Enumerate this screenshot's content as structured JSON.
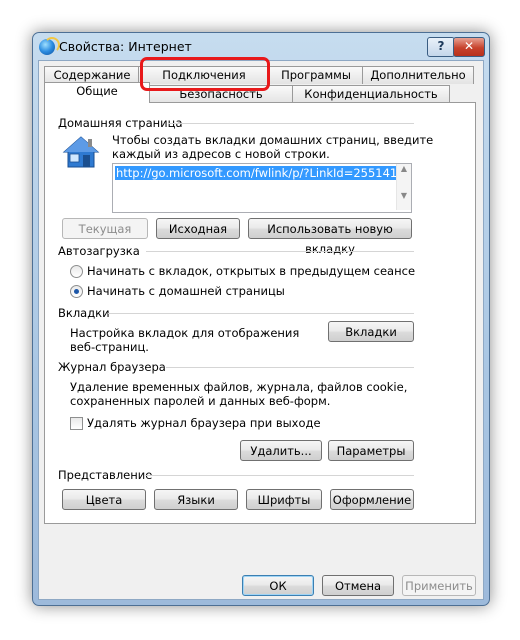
{
  "window": {
    "title": "Свойства: Интернет"
  },
  "titlebar": {
    "help_label": "?",
    "close_label": "✕"
  },
  "tabs_row1": [
    "Содержание",
    "Подключения",
    "Программы",
    "Дополнительно"
  ],
  "tabs_row2": [
    "Общие",
    "Безопасность",
    "Конфиденциальность"
  ],
  "home": {
    "heading": "Домашняя страница",
    "desc1": "Чтобы создать вкладки домашних страниц, введите",
    "desc2": "каждый из адресов с новой строки.",
    "url": "http://go.microsoft.com/fwlink/p/?LinkId=255141",
    "btn_current": "Текущая",
    "btn_default": "Исходная",
    "btn_newtab": "Использовать новую вкладку"
  },
  "startup": {
    "heading": "Автозагрузка",
    "option1": "Начинать с вкладок, открытых в предыдущем сеансе",
    "option2": "Начинать с домашней страницы",
    "selected": 2
  },
  "tabs_group": {
    "heading": "Вкладки",
    "desc1": "Настройка вкладок для отображения",
    "desc2": "веб-страниц.",
    "button": "Вкладки"
  },
  "history": {
    "heading": "Журнал браузера",
    "desc1": "Удаление временных файлов, журнала, файлов cookie,",
    "desc2": "сохраненных паролей и данных веб-форм.",
    "checkbox_label": "Удалять журнал браузера при выходе",
    "checked": false,
    "btn_delete": "Удалить...",
    "btn_settings": "Параметры"
  },
  "appearance": {
    "heading": "Представление",
    "btn_colors": "Цвета",
    "btn_languages": "Языки",
    "btn_fonts": "Шрифты",
    "btn_accessibility": "Оформление"
  },
  "footer": {
    "ok": "ОК",
    "cancel": "Отмена",
    "apply": "Применить"
  },
  "colors": {
    "highlight": "#e8191b",
    "selection": "#3399ff"
  }
}
